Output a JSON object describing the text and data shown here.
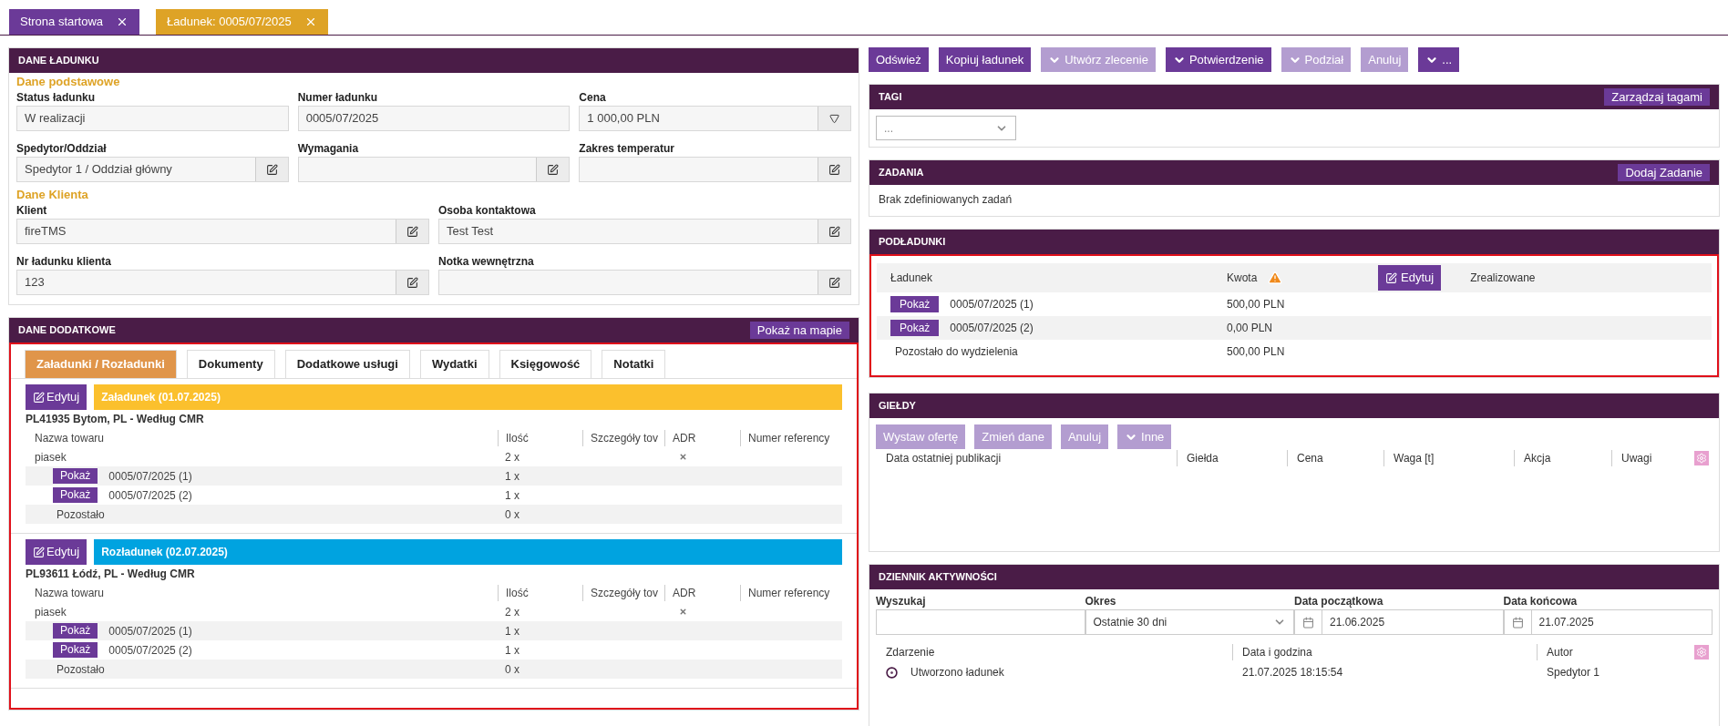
{
  "tabs": [
    {
      "label": "Strona startowa",
      "selected": false
    },
    {
      "label": "Ładunek: 0005/07/2025",
      "selected": true
    }
  ],
  "load_panel": {
    "title": "DANE ŁADUNKU",
    "sections": [
      {
        "heading": "Dane podstawowe",
        "fields": [
          {
            "label": "Status ładunku",
            "value": "W realizacji",
            "kind": "plain"
          },
          {
            "label": "Numer ładunku",
            "value": "0005/07/2025",
            "kind": "plain"
          },
          {
            "label": "Cena",
            "value": "1 000,00 PLN",
            "kind": "dropdown"
          },
          {
            "label": "Spedytor/Oddział",
            "value": "Spedytor 1 / Oddział główny",
            "kind": "edit"
          },
          {
            "label": "Wymagania",
            "kind": "edit"
          },
          {
            "label": "Zakres temperatur",
            "kind": "edit"
          }
        ]
      },
      {
        "heading": "Dane Klienta",
        "fields": [
          {
            "label": "Klient",
            "value": "fireTMS",
            "kind": "edit"
          },
          {
            "label": "Osoba kontaktowa",
            "value": "Test Test",
            "kind": "edit"
          },
          {
            "label": "Nr ładunku klienta",
            "value": "123",
            "kind": "edit"
          },
          {
            "label": "Notka wewnętrzna",
            "kind": "edit"
          }
        ]
      }
    ]
  },
  "extra_panel": {
    "title": "DANE DODATKOWE",
    "header_button": "Pokaż na mapie",
    "tabs": [
      {
        "label": "Załadunki / Rozładunki",
        "selected": true
      },
      {
        "label": "Dokumenty",
        "selected": false
      },
      {
        "label": "Dodatkowe usługi",
        "selected": false
      },
      {
        "label": "Wydatki",
        "selected": false
      },
      {
        "label": "Księgowość",
        "selected": false
      },
      {
        "label": "Notatki",
        "selected": false
      }
    ],
    "stops": [
      {
        "edit_button": "Edytuj",
        "title": "Załadunek (01.07.2025)",
        "color": "#fbc02d",
        "address": "PL41935 Bytom, PL - Według CMR",
        "columns": [
          "Nazwa towaru",
          "Ilość",
          "Szczegóły tov",
          "ADR",
          "Numer referency"
        ],
        "rows": [
          {
            "kind": "product",
            "name": "piasek",
            "qty": "2 x",
            "adr": false
          },
          {
            "kind": "sub",
            "button": "Pokaż",
            "name": "0005/07/2025 (1)",
            "qty": "1 x"
          },
          {
            "kind": "sub",
            "button": "Pokaż",
            "name": "0005/07/2025 (2)",
            "qty": "1 x"
          },
          {
            "kind": "rest",
            "name": "Pozostało",
            "qty": "0 x"
          }
        ]
      },
      {
        "edit_button": "Edytuj",
        "title": "Rozładunek (02.07.2025)",
        "color": "#00a3e0",
        "address": "PL93611 Łódź, PL - Według CMR",
        "columns": [
          "Nazwa towaru",
          "Ilość",
          "Szczegóły tov",
          "ADR",
          "Numer referency"
        ],
        "rows": [
          {
            "kind": "product",
            "name": "piasek",
            "qty": "2 x",
            "adr": false
          },
          {
            "kind": "sub",
            "button": "Pokaż",
            "name": "0005/07/2025 (1)",
            "qty": "1 x"
          },
          {
            "kind": "sub",
            "button": "Pokaż",
            "name": "0005/07/2025 (2)",
            "qty": "1 x"
          },
          {
            "kind": "rest",
            "name": "Pozostało",
            "qty": "0 x"
          }
        ]
      }
    ]
  },
  "toolbar": [
    {
      "label": "Odśwież",
      "disabled": false,
      "caret": false
    },
    {
      "label": "Kopiuj ładunek",
      "disabled": false,
      "caret": false
    },
    {
      "label": "Utwórz zlecenie",
      "disabled": true,
      "caret": true
    },
    {
      "label": "Potwierdzenie",
      "disabled": false,
      "caret": true
    },
    {
      "label": "Podział",
      "disabled": true,
      "caret": true
    },
    {
      "label": "Anuluj",
      "disabled": true,
      "caret": false
    },
    {
      "label": "...",
      "disabled": false,
      "caret": true
    }
  ],
  "tags_panel": {
    "title": "TAGI",
    "header_button": "Zarządzaj tagami",
    "select_value": "..."
  },
  "tasks_panel": {
    "title": "ZADANIA",
    "header_button": "Dodaj Zadanie",
    "empty_text": "Brak zdefiniowanych zadań"
  },
  "subloads_panel": {
    "title": "PODŁADUNKI",
    "columns": [
      "Ładunek",
      "Kwota",
      "Zrealizowane"
    ],
    "edit_button": "Edytuj",
    "rows": [
      {
        "kind": "sub",
        "button": "Pokaż",
        "name": "0005/07/2025 (1)",
        "amount": "500,00 PLN"
      },
      {
        "kind": "sub",
        "button": "Pokaż",
        "name": "0005/07/2025 (2)",
        "amount": "0,00 PLN"
      },
      {
        "kind": "rest",
        "name": "Pozostało do wydzielenia",
        "amount": "500,00 PLN"
      }
    ]
  },
  "exchanges_panel": {
    "title": "GIEŁDY",
    "buttons": [
      {
        "label": "Wystaw ofertę",
        "disabled": true,
        "caret": false
      },
      {
        "label": "Zmień dane",
        "disabled": true,
        "caret": false
      },
      {
        "label": "Anuluj",
        "disabled": true,
        "caret": false
      },
      {
        "label": "Inne",
        "disabled": true,
        "caret": true
      }
    ],
    "columns": [
      "Data ostatniej publikacji",
      "Giełda",
      "Cena",
      "Waga [t]",
      "Akcja",
      "Uwagi"
    ]
  },
  "activity_panel": {
    "title": "DZIENNIK AKTYWNOŚCI",
    "filters": [
      {
        "label": "Wyszukaj",
        "kind": "text"
      },
      {
        "label": "Okres",
        "kind": "select",
        "value": "Ostatnie 30 dni"
      },
      {
        "label": "Data początkowa",
        "kind": "date",
        "value": "21.06.2025"
      },
      {
        "label": "Data końcowa",
        "kind": "date",
        "value": "21.07.2025"
      }
    ],
    "columns": [
      "Zdarzenie",
      "Data i godzina",
      "Autor"
    ],
    "rows": [
      {
        "event": "Utworzono ładunek",
        "datetime": "21.07.2025 18:15:54",
        "author": "Spedytor 1"
      }
    ]
  }
}
